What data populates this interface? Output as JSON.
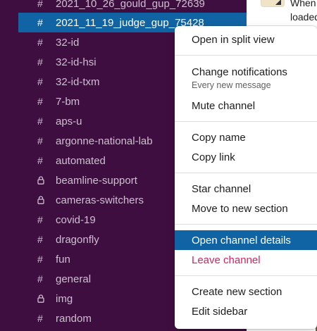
{
  "sidebar": {
    "channels": [
      {
        "name": "2021_10_26_gould_gup_72639",
        "icon": "hash-icon",
        "active": false
      },
      {
        "name": "2021_11_19_judge_gup_75428",
        "icon": "hash-icon",
        "active": true
      },
      {
        "name": "32-id",
        "icon": "hash-icon",
        "active": false
      },
      {
        "name": "32-id-hsi",
        "icon": "hash-icon",
        "active": false
      },
      {
        "name": "32-id-txm",
        "icon": "hash-icon",
        "active": false
      },
      {
        "name": "7-bm",
        "icon": "hash-icon",
        "active": false
      },
      {
        "name": "aps-u",
        "icon": "hash-icon",
        "active": false
      },
      {
        "name": "argonne-national-lab",
        "icon": "hash-icon",
        "active": false
      },
      {
        "name": "automated",
        "icon": "hash-icon",
        "active": false
      },
      {
        "name": "beamline-support",
        "icon": "lock-icon",
        "active": false
      },
      {
        "name": "cameras-switchers",
        "icon": "lock-icon",
        "active": false
      },
      {
        "name": "covid-19",
        "icon": "hash-icon",
        "active": false
      },
      {
        "name": "dragonfly",
        "icon": "hash-icon",
        "active": false
      },
      {
        "name": "fun",
        "icon": "hash-icon",
        "active": false
      },
      {
        "name": "general",
        "icon": "hash-icon",
        "active": false
      },
      {
        "name": "img",
        "icon": "lock-icon",
        "active": false
      },
      {
        "name": "random",
        "icon": "hash-icon",
        "active": false
      }
    ],
    "hash_symbol": "#"
  },
  "preview": {
    "line1": "When",
    "line2": "loaded"
  },
  "menu": {
    "open_split": "Open in split view",
    "change_notifications": "Change notifications",
    "notifications_sub": "Every new message",
    "mute": "Mute channel",
    "copy_name": "Copy name",
    "copy_link": "Copy link",
    "star": "Star channel",
    "move": "Move to new section",
    "open_details": "Open channel details",
    "leave": "Leave channel",
    "create_section": "Create new section",
    "edit_sidebar": "Edit sidebar"
  },
  "colors": {
    "sidebar_bg": "#3f0e40",
    "active_bg": "#1164a3",
    "danger": "#e01e5a"
  }
}
